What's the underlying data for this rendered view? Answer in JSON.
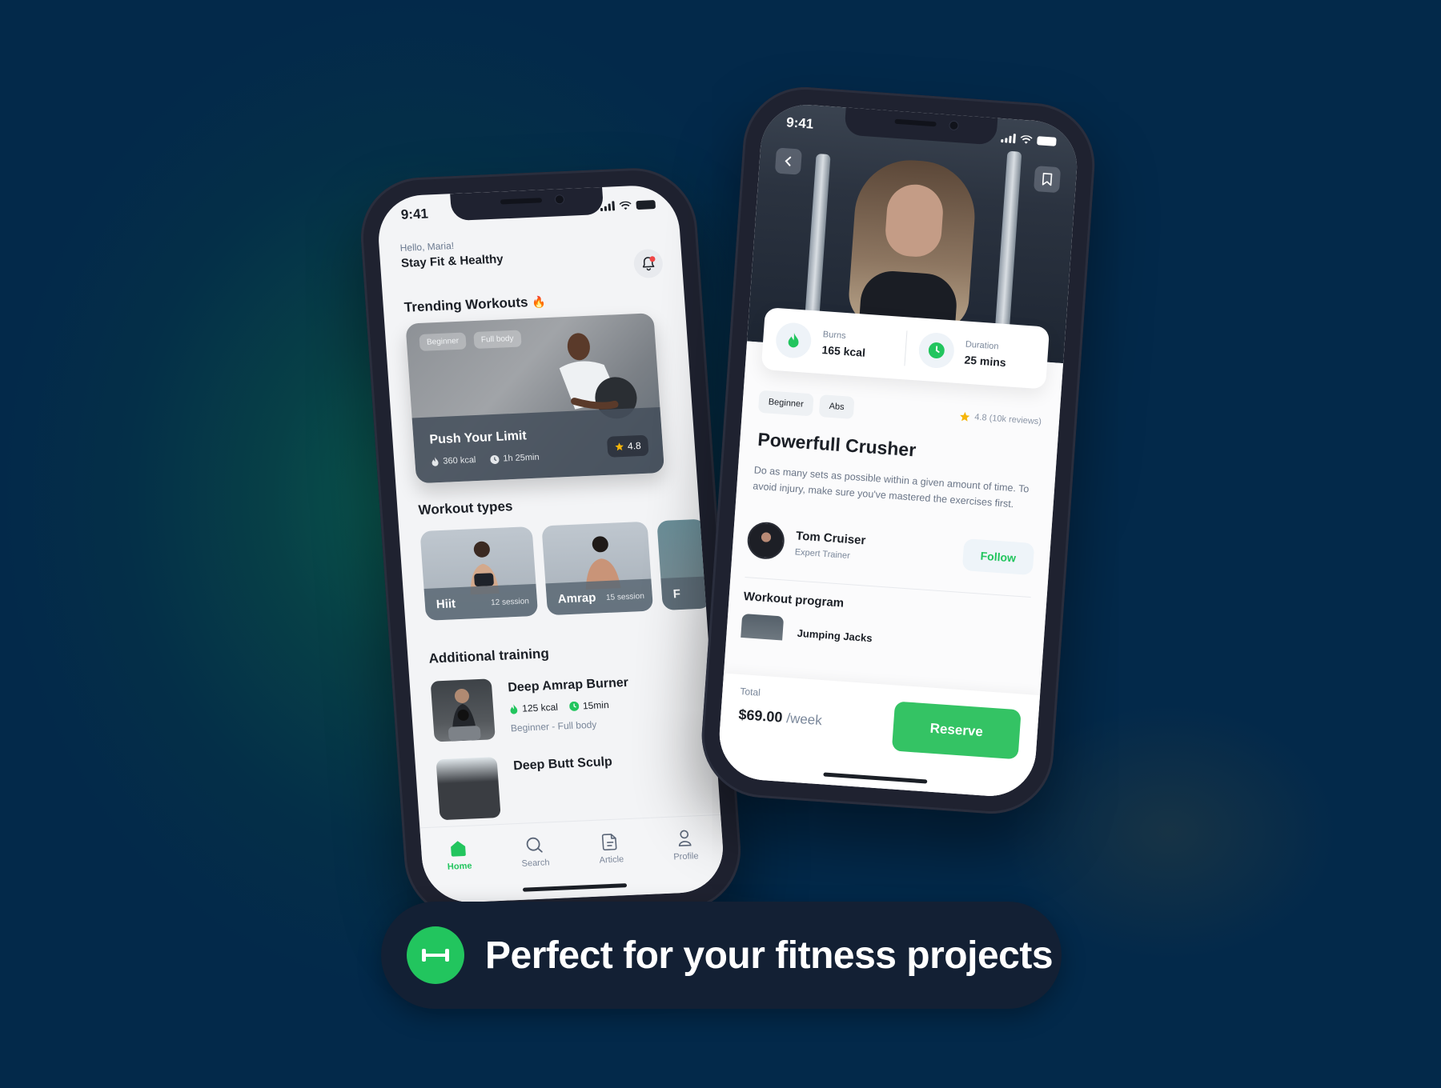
{
  "banner": {
    "icon": "dumbbell-icon",
    "text": "Perfect for your fitness projects"
  },
  "colors": {
    "accent": "#22c55e",
    "background": "#03294a",
    "rating_star": "#f5b50a",
    "notification_dot": "#ef4444"
  },
  "home_screen": {
    "status_time": "9:41",
    "greeting": "Hello, Maria!",
    "tagline": "Stay Fit & Healthy",
    "notification_icon": "bell-icon",
    "trending": {
      "title": "Trending Workouts",
      "title_emoji": "🔥",
      "card": {
        "tags": [
          "Beginner",
          "Full body"
        ],
        "title": "Push Your Limit",
        "calories": "360 kcal",
        "duration": "1h 25min",
        "rating": "4.8"
      }
    },
    "workout_types": {
      "title": "Workout types",
      "items": [
        {
          "name": "Hiit",
          "count": "12 session"
        },
        {
          "name": "Amrap",
          "count": "15 session"
        },
        {
          "name": "F",
          "count": ""
        }
      ]
    },
    "additional_training": {
      "title": "Additional training",
      "items": [
        {
          "title": "Deep Amrap Burner",
          "calories": "125 kcal",
          "duration": "15min",
          "subtitle": "Beginner - Full body"
        },
        {
          "title": "Deep Butt Sculp",
          "calories": "",
          "duration": "",
          "subtitle": ""
        }
      ]
    },
    "tabbar": [
      {
        "label": "Home",
        "icon": "home-icon",
        "active": true
      },
      {
        "label": "Search",
        "icon": "search-icon",
        "active": false
      },
      {
        "label": "Article",
        "icon": "article-icon",
        "active": false
      },
      {
        "label": "Profile",
        "icon": "profile-icon",
        "active": false
      }
    ]
  },
  "detail_screen": {
    "status_time": "9:41",
    "back_icon": "chevron-left-icon",
    "bookmark_icon": "bookmark-icon",
    "stats": [
      {
        "label": "Burns",
        "value": "165 kcal",
        "icon": "flame-icon"
      },
      {
        "label": "Duration",
        "value": "25 mins",
        "icon": "clock-icon"
      }
    ],
    "tags": [
      "Beginner",
      "Abs"
    ],
    "rating": "4.8 (10k reviews)",
    "title": "Powerfull Crusher",
    "description": "Do as many sets as possible within a given amount of time. To avoid injury, make sure you've mastered the exercises first.",
    "trainer": {
      "name": "Tom Cruiser",
      "role": "Expert Trainer",
      "follow_label": "Follow"
    },
    "program": {
      "title": "Workout program",
      "items": [
        "Jumping Jacks"
      ]
    },
    "footer": {
      "total_label": "Total",
      "price": "$69.00",
      "period": "/week",
      "reserve_label": "Reserve"
    }
  }
}
